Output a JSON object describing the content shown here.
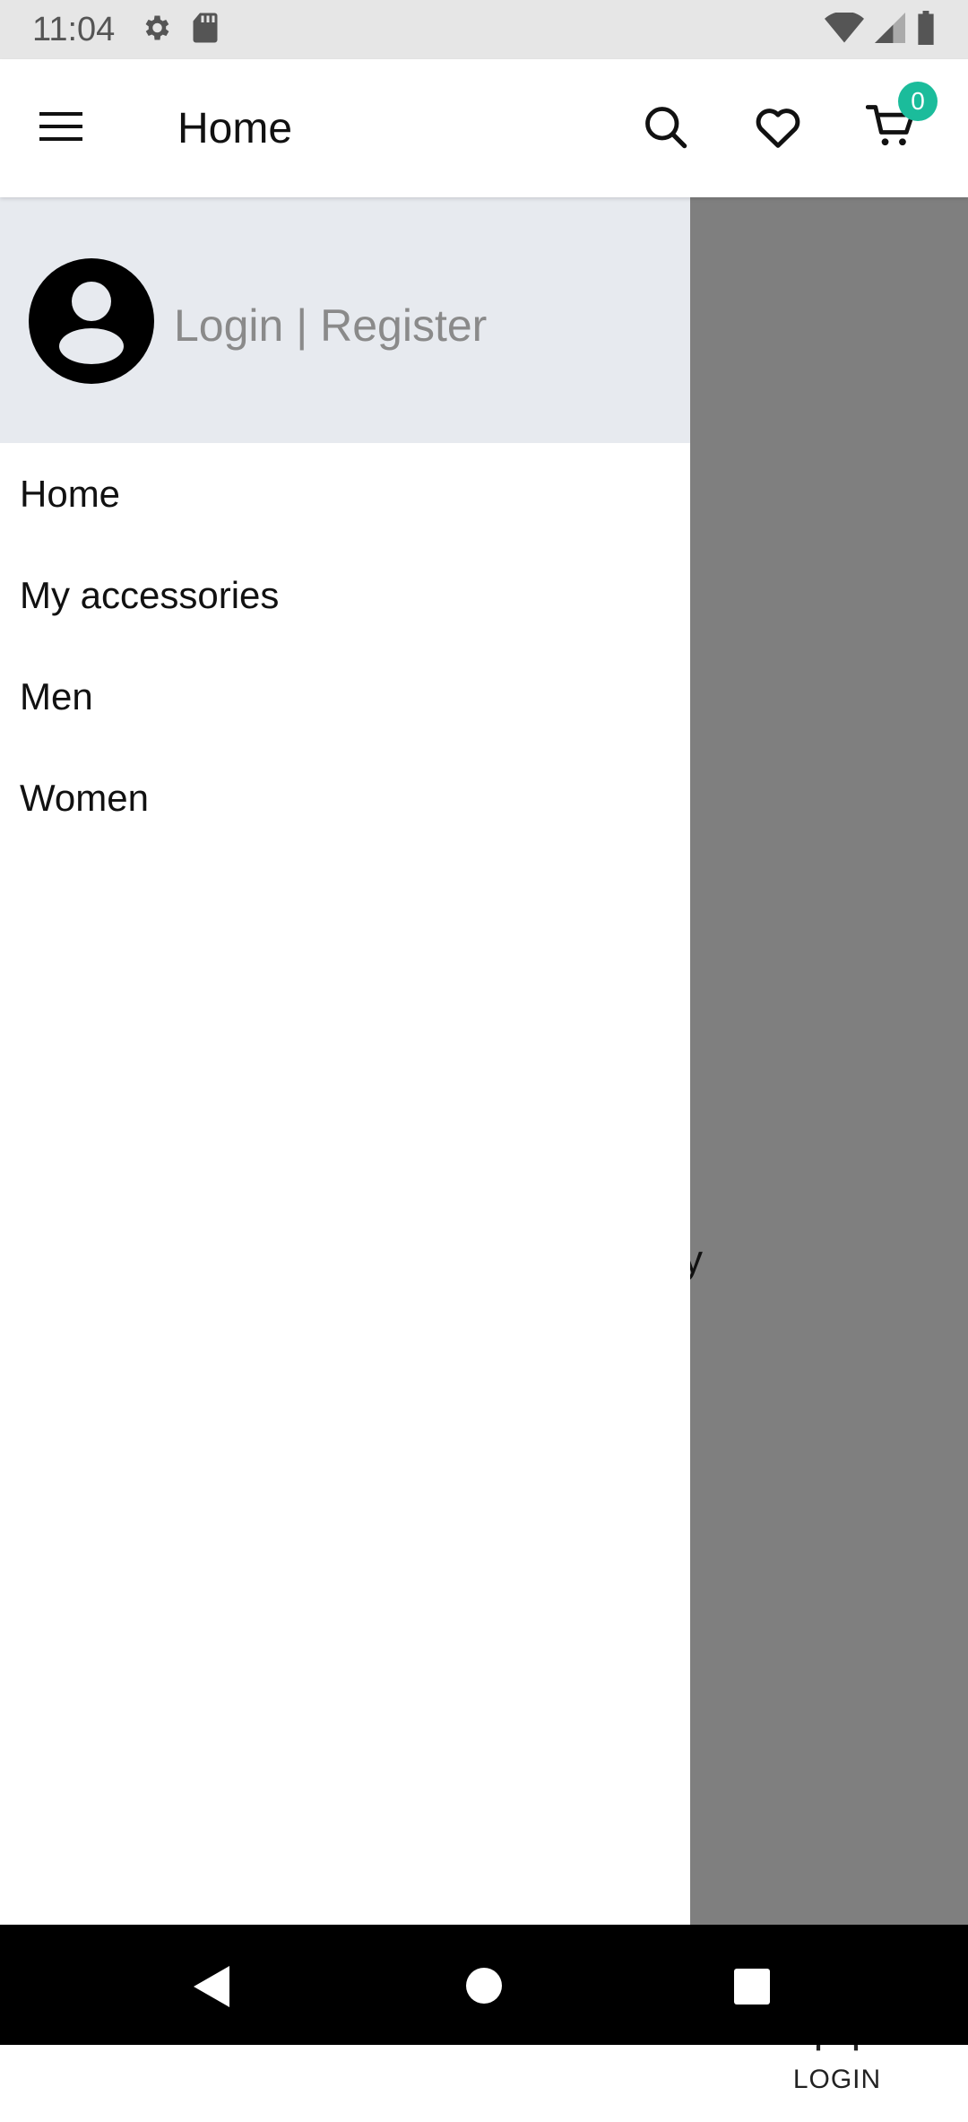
{
  "status_bar": {
    "time": "11:04",
    "icons": [
      "settings-icon",
      "sd-card-icon",
      "wifi-icon",
      "cellular-signal-icon",
      "battery-icon"
    ]
  },
  "header": {
    "title": "Home",
    "cart_count": "0",
    "icons": [
      "menu-icon",
      "search-icon",
      "heart-icon",
      "cart-icon"
    ],
    "badge_color": "#1bbc9b"
  },
  "drawer": {
    "login_label": "Login | Register",
    "header_bg": "#e7eaef",
    "items": [
      {
        "label": "Home"
      },
      {
        "label": "My accessories"
      },
      {
        "label": "Men"
      },
      {
        "label": "Women"
      }
    ]
  },
  "background_page": {
    "partial_text": "y",
    "bottom_nav_login": "LOGIN"
  },
  "system_nav": {
    "icons": [
      "back-icon",
      "home-icon",
      "recents-icon"
    ]
  }
}
